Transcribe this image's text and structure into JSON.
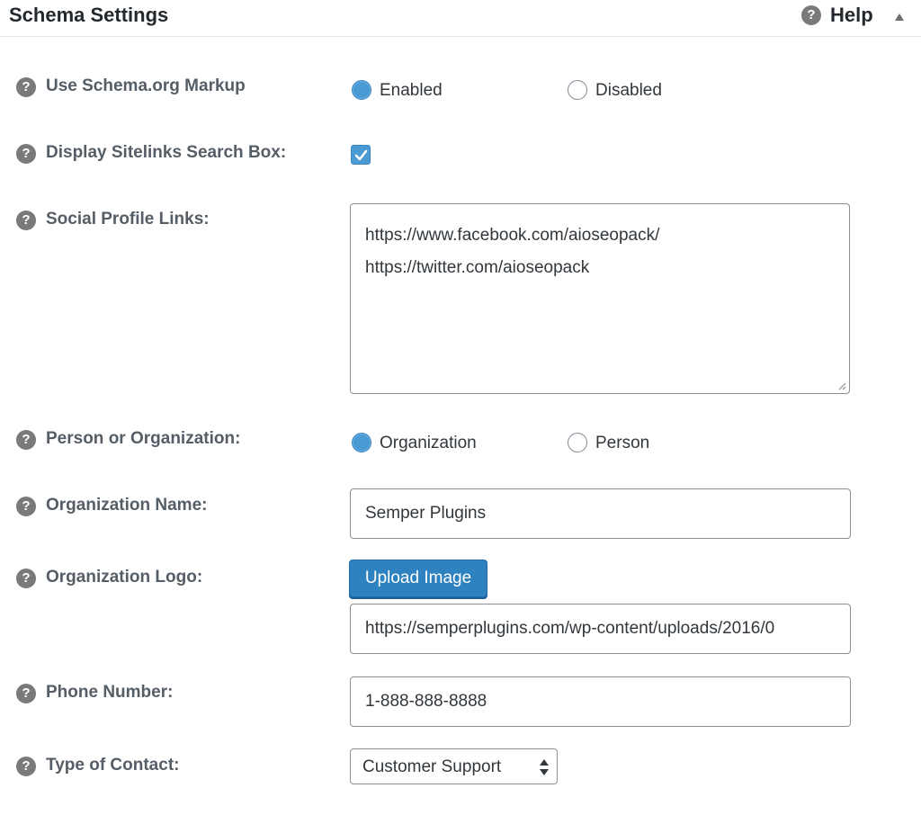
{
  "header": {
    "title": "Schema Settings",
    "help_icon_glyph": "?",
    "help_label": "Help"
  },
  "colors": {
    "accent": "#4a9ad4",
    "button": "#2e82c0",
    "label": "#555d66",
    "help_icon": "#7a7a7a"
  },
  "help_glyph": "?",
  "fields": {
    "schema_markup": {
      "label": "Use Schema.org Markup",
      "options": [
        "Enabled",
        "Disabled"
      ],
      "selected": "Enabled"
    },
    "sitelinks_search": {
      "label": "Display Sitelinks Search Box:",
      "checked": true
    },
    "social_profiles": {
      "label": "Social Profile Links:",
      "lines": [
        "https://www.facebook.com/aioseopack/",
        "https://twitter.com/aioseopack"
      ]
    },
    "person_or_org": {
      "label": "Person or Organization:",
      "options": [
        "Organization",
        "Person"
      ],
      "selected": "Organization"
    },
    "org_name": {
      "label": "Organization Name:",
      "value": "Semper Plugins"
    },
    "org_logo": {
      "label": "Organization Logo:",
      "button_label": "Upload Image",
      "value": "https://semperplugins.com/wp-content/uploads/2016/0"
    },
    "phone": {
      "label": "Phone Number:",
      "value": "1-888-888-8888"
    },
    "contact_type": {
      "label": "Type of Contact:",
      "selected": "Customer Support"
    }
  },
  "icons": {
    "help": "question-circle-icon",
    "collapse": "triangle-up-icon",
    "check": "checkmark-icon",
    "select_arrows": "up-down-arrows-icon",
    "resize": "resize-grip-icon"
  }
}
